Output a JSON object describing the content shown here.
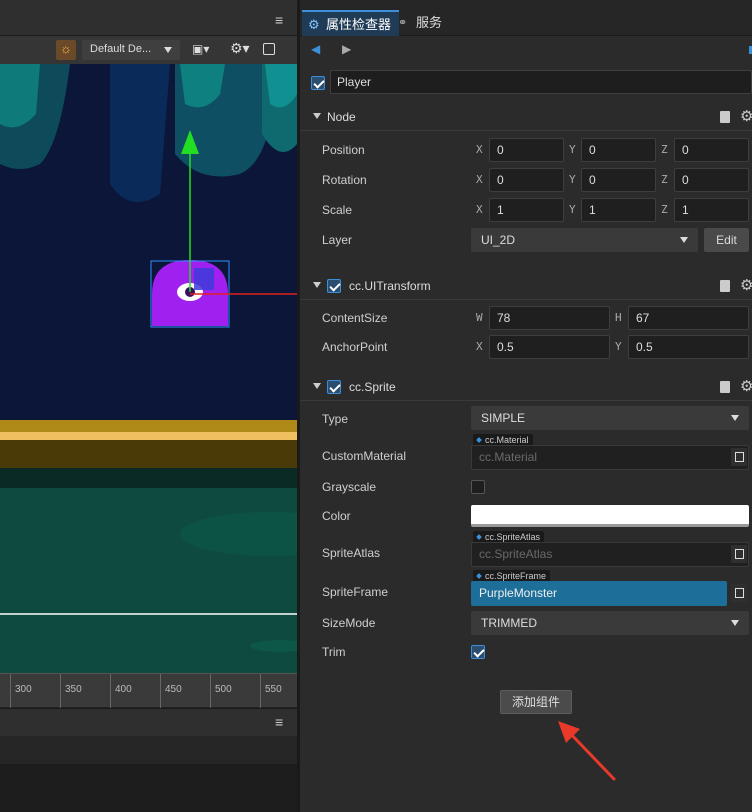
{
  "scene": {
    "toolbar": {
      "lighting_icon": "sun-icon",
      "camera_select": "Default De...",
      "camera_icon": "camera-icon",
      "settings_icon": "gear-icon",
      "layout_icon": "grid-icon",
      "menu_icon": "hamburger-icon"
    },
    "ruler": [
      "300",
      "350",
      "400",
      "450",
      "500",
      "550"
    ],
    "colors": {
      "sky": "#0c1a3c",
      "purple": "#a020f0",
      "gold": "#b08a18",
      "ground": "#0f4a3e"
    }
  },
  "inspector": {
    "tabs": [
      {
        "label": "属性检查器",
        "icon": "gear-icon"
      },
      {
        "label": "服务",
        "icon": "link-icon"
      }
    ],
    "node_name": "Player",
    "node_enabled": true,
    "sections": {
      "node": {
        "title": "Node"
      },
      "uitransform": {
        "title": "cc.UITransform",
        "enabled": true
      },
      "sprite": {
        "title": "cc.Sprite",
        "enabled": true
      }
    },
    "node": {
      "position": {
        "label": "Position",
        "x": "0",
        "y": "0",
        "z": "0"
      },
      "rotation": {
        "label": "Rotation",
        "x": "0",
        "y": "0",
        "z": "0"
      },
      "scale": {
        "label": "Scale",
        "x": "1",
        "y": "1",
        "z": "1"
      },
      "layer": {
        "label": "Layer",
        "value": "UI_2D",
        "edit": "Edit"
      }
    },
    "axis_labels": {
      "x": "X",
      "y": "Y",
      "z": "Z",
      "w": "W",
      "h": "H"
    },
    "uitransform": {
      "content_size": {
        "label": "ContentSize",
        "w": "78",
        "h": "67"
      },
      "anchor_point": {
        "label": "AnchorPoint",
        "x": "0.5",
        "y": "0.5"
      }
    },
    "sprite": {
      "type": {
        "label": "Type",
        "value": "SIMPLE"
      },
      "custom_material": {
        "label": "CustomMaterial",
        "tag": "cc.Material",
        "placeholder": "cc.Material"
      },
      "grayscale": {
        "label": "Grayscale",
        "checked": false
      },
      "color": {
        "label": "Color",
        "value": "#ffffff"
      },
      "sprite_atlas": {
        "label": "SpriteAtlas",
        "tag": "cc.SpriteAtlas",
        "placeholder": "cc.SpriteAtlas"
      },
      "sprite_frame": {
        "label": "SpriteFrame",
        "tag": "cc.SpriteFrame",
        "value": "PurpleMonster"
      },
      "size_mode": {
        "label": "SizeMode",
        "value": "TRIMMED"
      },
      "trim": {
        "label": "Trim",
        "checked": true
      }
    },
    "add_component": "添加组件"
  }
}
